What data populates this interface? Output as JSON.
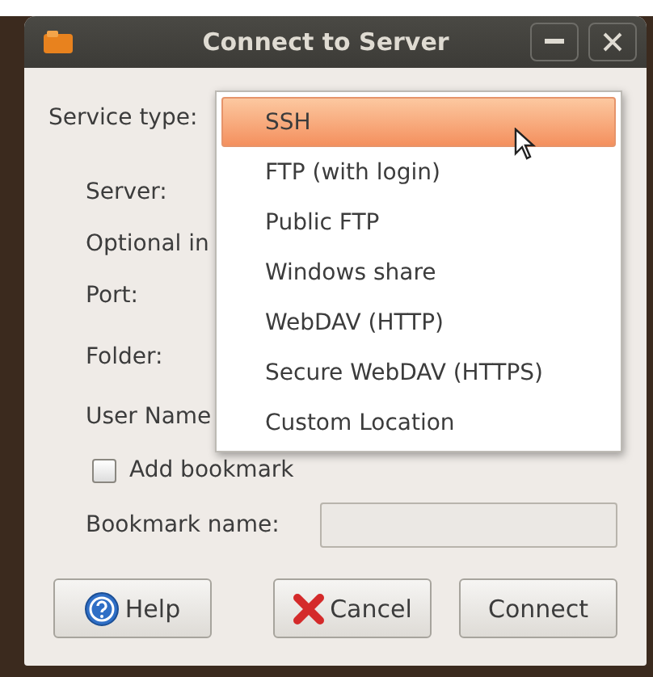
{
  "window": {
    "title": "Connect to Server"
  },
  "form": [
    {
      "kind": "label",
      "label": "Service type:"
    },
    {
      "kind": "label",
      "label": "Server:"
    },
    {
      "kind": "label",
      "label": "Optional in"
    },
    {
      "kind": "label",
      "label": "Port:"
    },
    {
      "kind": "label",
      "label": "Folder:"
    },
    {
      "kind": "label",
      "label": "User Name"
    },
    {
      "kind": "checkbox",
      "label": "Add bookmark",
      "checked": false
    },
    {
      "kind": "text_input",
      "label": "Bookmark name:",
      "disabled": true
    }
  ],
  "dropdown": [
    {
      "label": "SSH",
      "selected": true
    },
    {
      "label": "FTP (with login)",
      "selected": false
    },
    {
      "label": "Public FTP",
      "selected": false
    },
    {
      "label": "Windows share",
      "selected": false
    },
    {
      "label": "WebDAV (HTTP)",
      "selected": false
    },
    {
      "label": "Secure WebDAV (HTTPS)",
      "selected": false
    },
    {
      "label": "Custom Location",
      "selected": false
    }
  ],
  "buttons": [
    {
      "kind": "help",
      "label": "Help"
    },
    {
      "kind": "cancel",
      "label": "Cancel"
    },
    {
      "kind": "plain",
      "label": "Connect"
    }
  ]
}
